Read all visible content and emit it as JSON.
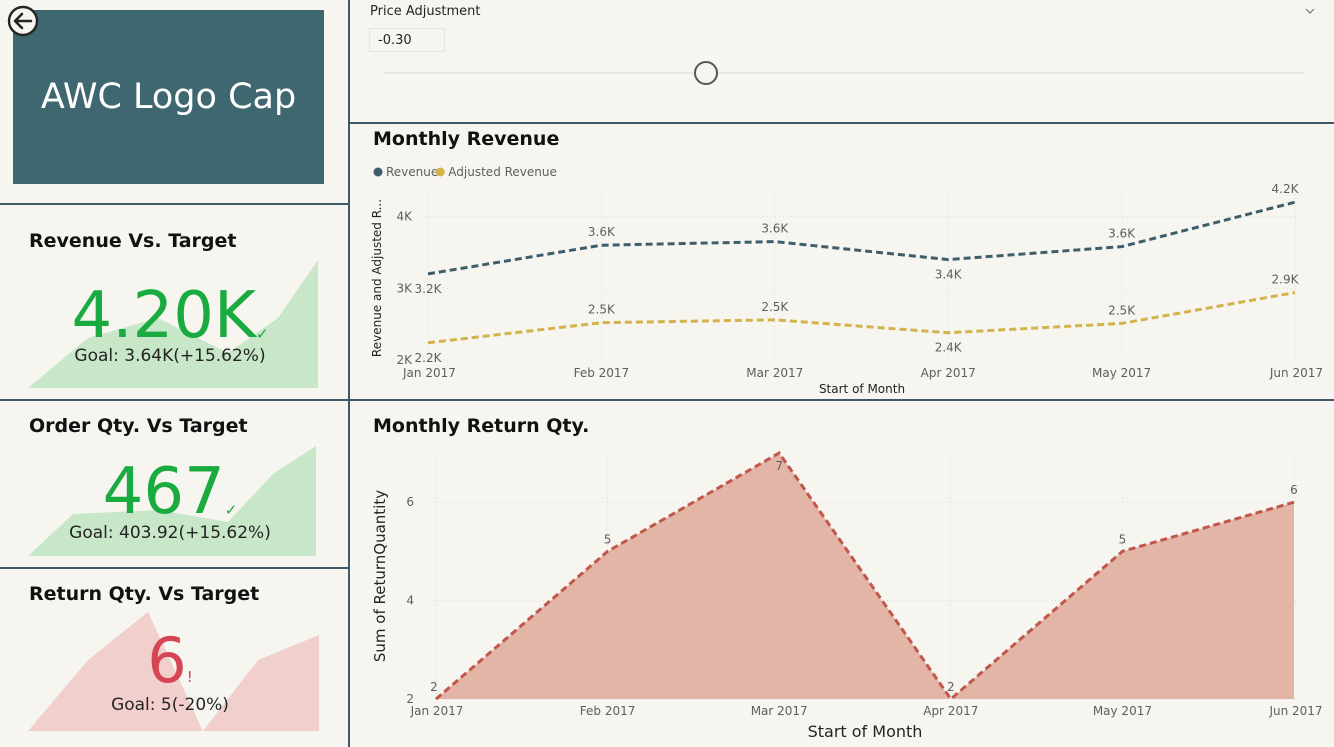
{
  "logo": {
    "title": "AWC Logo Cap"
  },
  "kpis": [
    {
      "title": "Revenue Vs. Target",
      "value": "4.20K",
      "goal_label": "Goal:",
      "goal_value": "3.64K",
      "goal_delta": "(+15.62%)",
      "status": "ok",
      "value_color": "#1aab40",
      "mark": "✓"
    },
    {
      "title": "Order Qty. Vs Target",
      "value": "467",
      "goal_label": "Goal:",
      "goal_value": "403.92",
      "goal_delta": "(+15.62%)",
      "status": "ok",
      "value_color": "#1aab40",
      "mark": "✓"
    },
    {
      "title": "Return Qty. Vs Target",
      "value": "6",
      "goal_label": "Goal:",
      "goal_value": "5",
      "goal_delta": "(-20%)",
      "status": "warn",
      "value_color": "#d64554",
      "mark": "!"
    }
  ],
  "slicer": {
    "label": "Price Adjustment",
    "value": "-0.30",
    "fraction": 0.35
  },
  "revenue_panel": {
    "title": "Monthly Revenue"
  },
  "returns_panel": {
    "title": "Monthly Return Qty."
  },
  "chart_data": [
    {
      "type": "line",
      "title": "Monthly Revenue",
      "categories": [
        "Jan 2017",
        "Feb 2017",
        "Mar 2017",
        "Apr 2017",
        "May 2017",
        "Jun 2017"
      ],
      "xlabel": "Start of Month",
      "ylabel": "Revenue and Adjusted R...",
      "ylim": [
        2000,
        4300
      ],
      "yticks": [
        "2K",
        "3K",
        "4K"
      ],
      "legend_position": "top-left",
      "series": [
        {
          "name": "Revenue",
          "color": "#3f5e6b",
          "values": [
            3200,
            3600,
            3650,
            3400,
            3580,
            4200
          ],
          "labels": [
            "3.2K",
            "3.6K",
            "3.6K",
            "3.4K",
            "3.6K",
            "4.2K"
          ]
        },
        {
          "name": "Adjusted Revenue",
          "color": "#d4b24c",
          "values": [
            2240,
            2520,
            2560,
            2380,
            2510,
            2940
          ],
          "labels": [
            "2.2K",
            "2.5K",
            "2.5K",
            "2.4K",
            "2.5K",
            "2.9K"
          ]
        }
      ]
    },
    {
      "type": "area",
      "title": "Monthly Return Qty.",
      "categories": [
        "Jan 2017",
        "Feb 2017",
        "Mar 2017",
        "Apr 2017",
        "May 2017",
        "Jun 2017"
      ],
      "xlabel": "Start of Month",
      "ylabel": "Sum of ReturnQuantity",
      "ylim": [
        2,
        7
      ],
      "yticks": [
        "2",
        "4",
        "6"
      ],
      "series": [
        {
          "color": "#c0574a",
          "fill": "#e2b5a6",
          "values": [
            2,
            5,
            7,
            2,
            5,
            6
          ],
          "labels": [
            "2",
            "5",
            "7",
            "2",
            "5",
            "6"
          ]
        }
      ]
    }
  ]
}
